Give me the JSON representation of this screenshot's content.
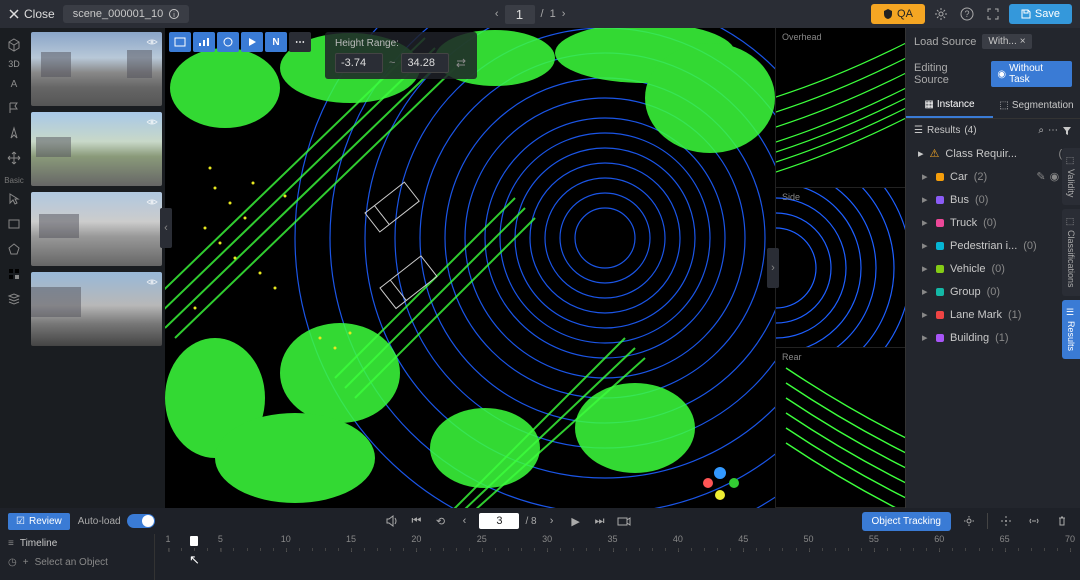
{
  "topbar": {
    "close_label": "Close",
    "scene_name": "scene_000001_10",
    "page_current": "1",
    "page_total": "1",
    "qa_label": "QA",
    "save_label": "Save"
  },
  "left_tools": {
    "label3d": "3D",
    "basic_label": "Basic"
  },
  "height_range": {
    "title": "Height Range:",
    "min": "-3.74",
    "sep": "~",
    "max": "34.28"
  },
  "right_views": {
    "overhead": "Overhead",
    "side": "Side",
    "rear": "Rear"
  },
  "right_panel": {
    "load_source_label": "Load Source",
    "load_chip": "With...",
    "editing_source_label": "Editing Source",
    "without_task_label": "Without Task",
    "tabs": {
      "instance": "Instance",
      "segmentation": "Segmentation"
    },
    "results_label": "Results",
    "results_count": "(4)",
    "warning": {
      "label": "Class Requir...",
      "count": "(0)"
    },
    "classes": [
      {
        "name": "Car",
        "count": "(2)",
        "color": "#f59e0b",
        "has_actions": true
      },
      {
        "name": "Bus",
        "count": "(0)",
        "color": "#8b5cf6"
      },
      {
        "name": "Truck",
        "count": "(0)",
        "color": "#ec4899"
      },
      {
        "name": "Pedestrian i...",
        "count": "(0)",
        "color": "#06b6d4"
      },
      {
        "name": "Vehicle",
        "count": "(0)",
        "color": "#84cc16"
      },
      {
        "name": "Group",
        "count": "(0)",
        "color": "#14b8a6"
      },
      {
        "name": "Lane Mark",
        "count": "(1)",
        "color": "#ef4444"
      },
      {
        "name": "Building",
        "count": "(1)",
        "color": "#a855f7"
      }
    ]
  },
  "side_tabs": {
    "validity": "Validity",
    "classifications": "Classifications",
    "results": "Results"
  },
  "bottom": {
    "review_label": "Review",
    "autoload_label": "Auto-load",
    "frame_current": "3",
    "frame_total": "/ 8",
    "object_tracking_label": "Object Tracking",
    "timeline_label": "Timeline",
    "select_object_label": "Select an Object",
    "ticks": [
      "1",
      "5",
      "10",
      "15",
      "20",
      "25",
      "30",
      "35",
      "40",
      "45",
      "50",
      "55",
      "60",
      "65",
      "70"
    ],
    "tick_end": 70,
    "playhead_value": 3
  },
  "colors": {
    "accent": "#3a7bd5",
    "warning": "#f5a623",
    "lidar_green": "#3cff3c",
    "lidar_blue": "#1e5fff",
    "lidar_yellow": "#e8e820"
  }
}
